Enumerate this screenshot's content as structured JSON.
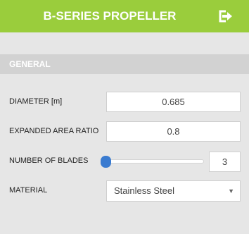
{
  "header": {
    "title": "B-SERIES PROPELLER",
    "exit_icon": "exit-icon"
  },
  "section": {
    "title": "GENERAL"
  },
  "fields": {
    "diameter": {
      "label": "DIAMETER [m]",
      "value": "0.685"
    },
    "expanded_area_ratio": {
      "label": "EXPANDED AREA RATIO",
      "value": "0.8"
    },
    "number_of_blades": {
      "label": "NUMBER OF BLADES",
      "value": "3",
      "slider_fraction": 0.0
    },
    "material": {
      "label": "MATERIAL",
      "value": "Stainless Steel",
      "arrow_icon": "dropdown-arrow-icon"
    }
  },
  "colors": {
    "header_bg": "#9acd3c",
    "section_bg": "#d2d2d2",
    "page_bg": "#e6e6e6",
    "slider_accent": "#3a7bd0"
  }
}
